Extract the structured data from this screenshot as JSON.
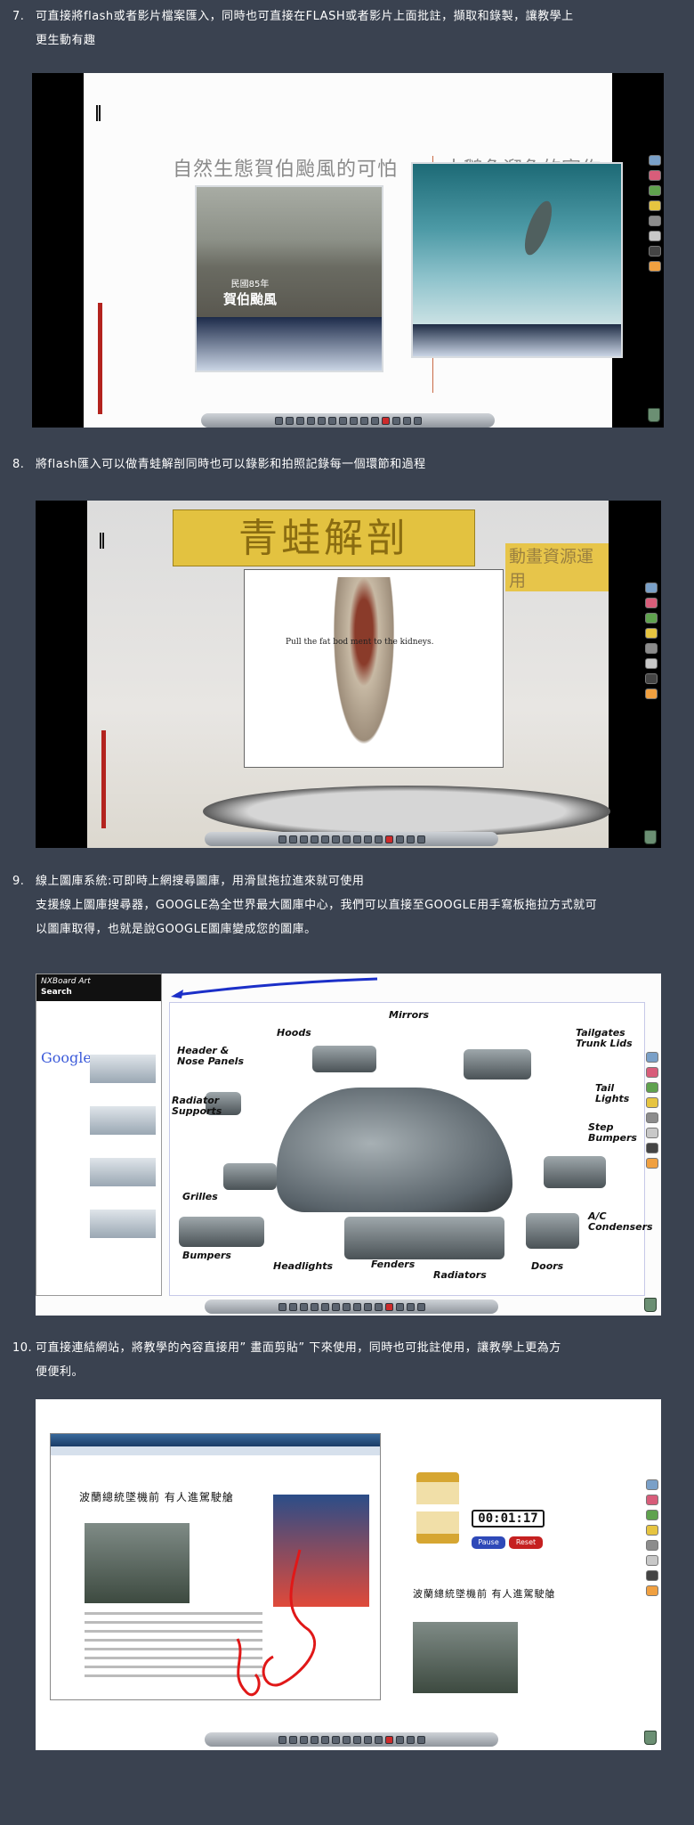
{
  "items": [
    {
      "number": "7.",
      "line1": "可直接將flash或者影片檔案匯入，同時也可直接在FLASH或者影片上面批註，擷取和錄製，讓教學上",
      "line2": "更生動有趣"
    },
    {
      "number": "8.",
      "line1": "將flash匯入可以做青蛙解剖同時也可以錄影和拍照記錄每一個環節和過程"
    },
    {
      "number": "9.",
      "line1": "線上圖庫系統:可即時上網搜尋圖庫，用滑鼠拖拉進來就可使用",
      "line2": "支援線上圖庫搜尋器，GOOGLE為全世界最大圖庫中心，我們可以直接至GOOGLE用手寫板拖拉方式就可",
      "line3": "以圖庫取得，也就是說GOOGLE圖庫變成您的圖庫。"
    },
    {
      "number": "10.",
      "line1": "可直接連結網站，將教學的內容直接用” 畫面剪貼” 下來使用，同時也可批註使用，讓教學上更為方",
      "line2": "便便利。"
    }
  ],
  "shot1": {
    "left_title": "自然生態賀伯颱風的可怕",
    "right_title": "大鵝魚溜魚的寫作",
    "video_caption_small": "民國85年",
    "video_caption_big": "賀伯颱風"
  },
  "shot2": {
    "title": "青蛙解剖",
    "subtitle": "動畫資源運用",
    "panel_text": "Pull the fat bod          ment to the kidneys."
  },
  "shot3": {
    "browser_title": "NXBoard Art",
    "search_label": "Search",
    "google_logo": "Google",
    "labels": {
      "hoods": "Hoods",
      "mirrors": "Mirrors",
      "header": "Header &\nNose Panels",
      "tailgates": "Tailgates\nTrunk Lids",
      "radiator_supports": "Radiator\nSupports",
      "tail_lights": "Tail\nLights",
      "step_bumpers": "Step\nBumpers",
      "grilles": "Grilles",
      "ac": "A/C\nCondensers",
      "bumpers": "Bumpers",
      "headlights": "Headlights",
      "fenders": "Fenders",
      "radiators": "Radiators",
      "doors": "Doors"
    }
  },
  "shot4": {
    "headline": "波蘭總統墜機前 有人進駕駛艙",
    "timer": "00:01:17",
    "pause_label": "Pause",
    "reset_label": "Reset"
  },
  "colors": {
    "page_bg": "#3a4250",
    "text": "#ffffff"
  }
}
